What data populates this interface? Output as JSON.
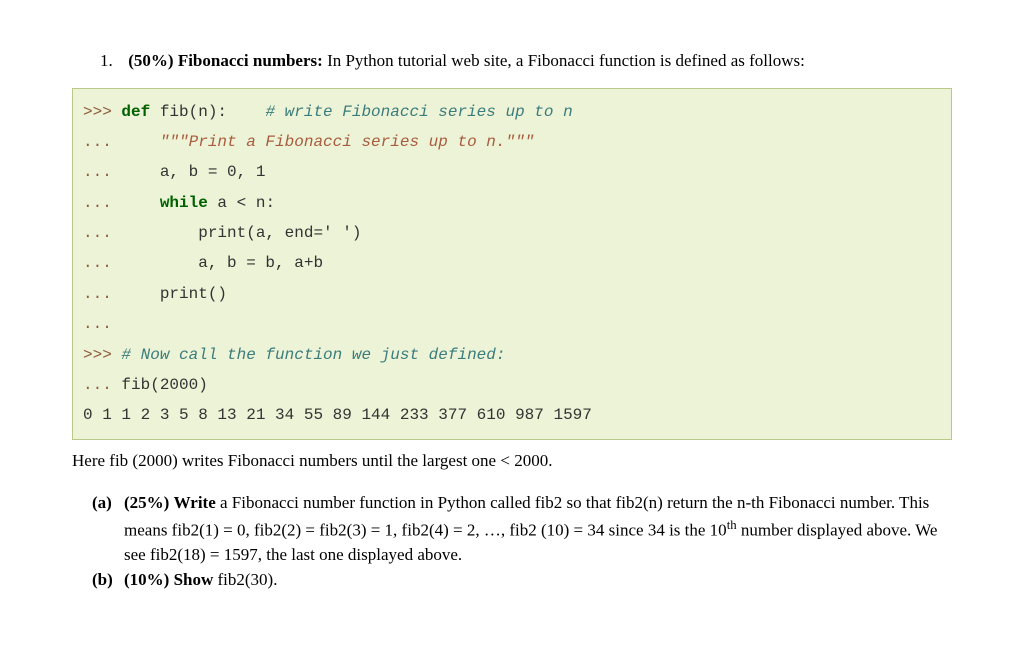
{
  "question": {
    "number": "1.",
    "weight": "(50%)",
    "title": "Fibonacci numbers:",
    "desc": "In Python tutorial web site, a Fibonacci function is defined as follows:"
  },
  "code": {
    "l1_prompt": ">>> ",
    "l1_def": "def",
    "l1_fn": " fib(n):    ",
    "l1_comment": "# write Fibonacci series up to n",
    "l2_prompt": "...     ",
    "l2_doc": "\"\"\"Print a Fibonacci series up to n.\"\"\"",
    "l3_prompt": "...     ",
    "l3_code": "a, b = 0, 1",
    "l4_prompt": "...     ",
    "l4_kw": "while",
    "l4_rest": " a < n:",
    "l5_prompt": "...         ",
    "l5_code": "print(a, end=' ')",
    "l6_prompt": "...         ",
    "l6_code": "a, b = b, a+b",
    "l7_prompt": "...     ",
    "l7_code": "print()",
    "l8_prompt": "...",
    "l9_prompt": ">>> ",
    "l9_comment": "# Now call the function we just defined:",
    "l10_prompt": "... ",
    "l10_code": "fib(2000)",
    "l11_out": "0 1 1 2 3 5 8 13 21 34 55 89 144 233 377 610 987 1597"
  },
  "post": "Here fib (2000) writes Fibonacci numbers until the largest one < 2000.",
  "parts": {
    "a": {
      "label": "(a)",
      "weight": "(25%)",
      "verb": "Write",
      "t1": " a Fibonacci number function in Python called fib2 so that fib2(n) return the n-th Fibonacci number. This means fib2(1) = 0, fib2(2) = fib2(3) = 1, fib2(4) = 2, …, fib2 (10) = 34 since 34 is the 10",
      "sup": "th",
      "t2": " number displayed above. We see fib2(18) = 1597, the last one displayed above."
    },
    "b": {
      "label": "(b)",
      "weight": "(10%)",
      "verb": "Show",
      "t1": " fib2(30)."
    }
  }
}
